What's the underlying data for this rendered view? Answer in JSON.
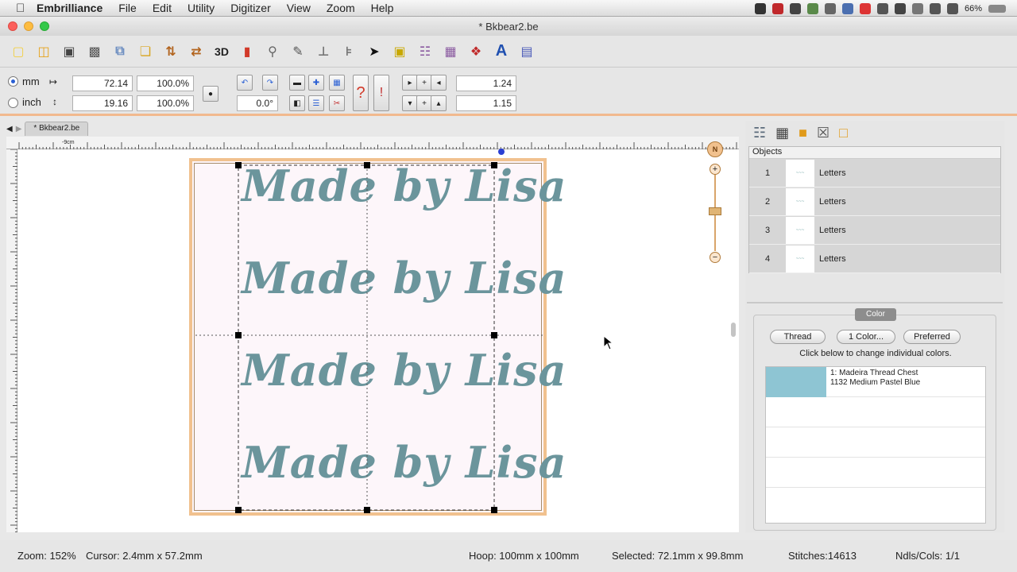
{
  "menubar": {
    "app_name": "Embrilliance",
    "items": [
      "File",
      "Edit",
      "Utility",
      "Digitizer",
      "View",
      "Zoom",
      "Help"
    ],
    "battery": "66%"
  },
  "window": {
    "title": "* Bkbear2.be"
  },
  "toolbar": {
    "label_3d": "3D",
    "label_text": "A"
  },
  "props": {
    "unit_mm": "mm",
    "unit_inch": "inch",
    "width": "72.14",
    "width_pct": "100.0%",
    "height": "19.16",
    "height_pct": "100.0%",
    "rotation": "0.0°",
    "spacing_h": "1.24",
    "spacing_v": "1.15"
  },
  "tabs": {
    "active": "* Bkbear2.be"
  },
  "canvas": {
    "lettering": [
      "Made by Lisa",
      "Made by Lisa",
      "Made by Lisa",
      "Made by Lisa"
    ],
    "ruler_label": "-9cm",
    "compass_label": "N"
  },
  "objects": {
    "header": "Objects",
    "rows": [
      {
        "num": "1",
        "label": "Letters"
      },
      {
        "num": "2",
        "label": "Letters"
      },
      {
        "num": "3",
        "label": "Letters"
      },
      {
        "num": "4",
        "label": "Letters"
      }
    ]
  },
  "color_panel": {
    "title": "Color",
    "thread_btn": "Thread",
    "one_color_btn": "1 Color...",
    "preferred_btn": "Preferred",
    "hint": "Click below to change individual colors.",
    "thread_line1": "1: Madeira Thread Chest",
    "thread_line2": "1132 Medium Pastel Blue",
    "swatch_color": "#8ec5d3"
  },
  "status": {
    "zoom": "Zoom: 152%",
    "cursor": "Cursor: 2.4mm x 57.2mm",
    "hoop": "Hoop: 100mm x 100mm",
    "selected": "Selected: 72.1mm x 99.8mm",
    "stitches": "Stitches:14613",
    "ndls": "Ndls/Cols: 1/1"
  }
}
